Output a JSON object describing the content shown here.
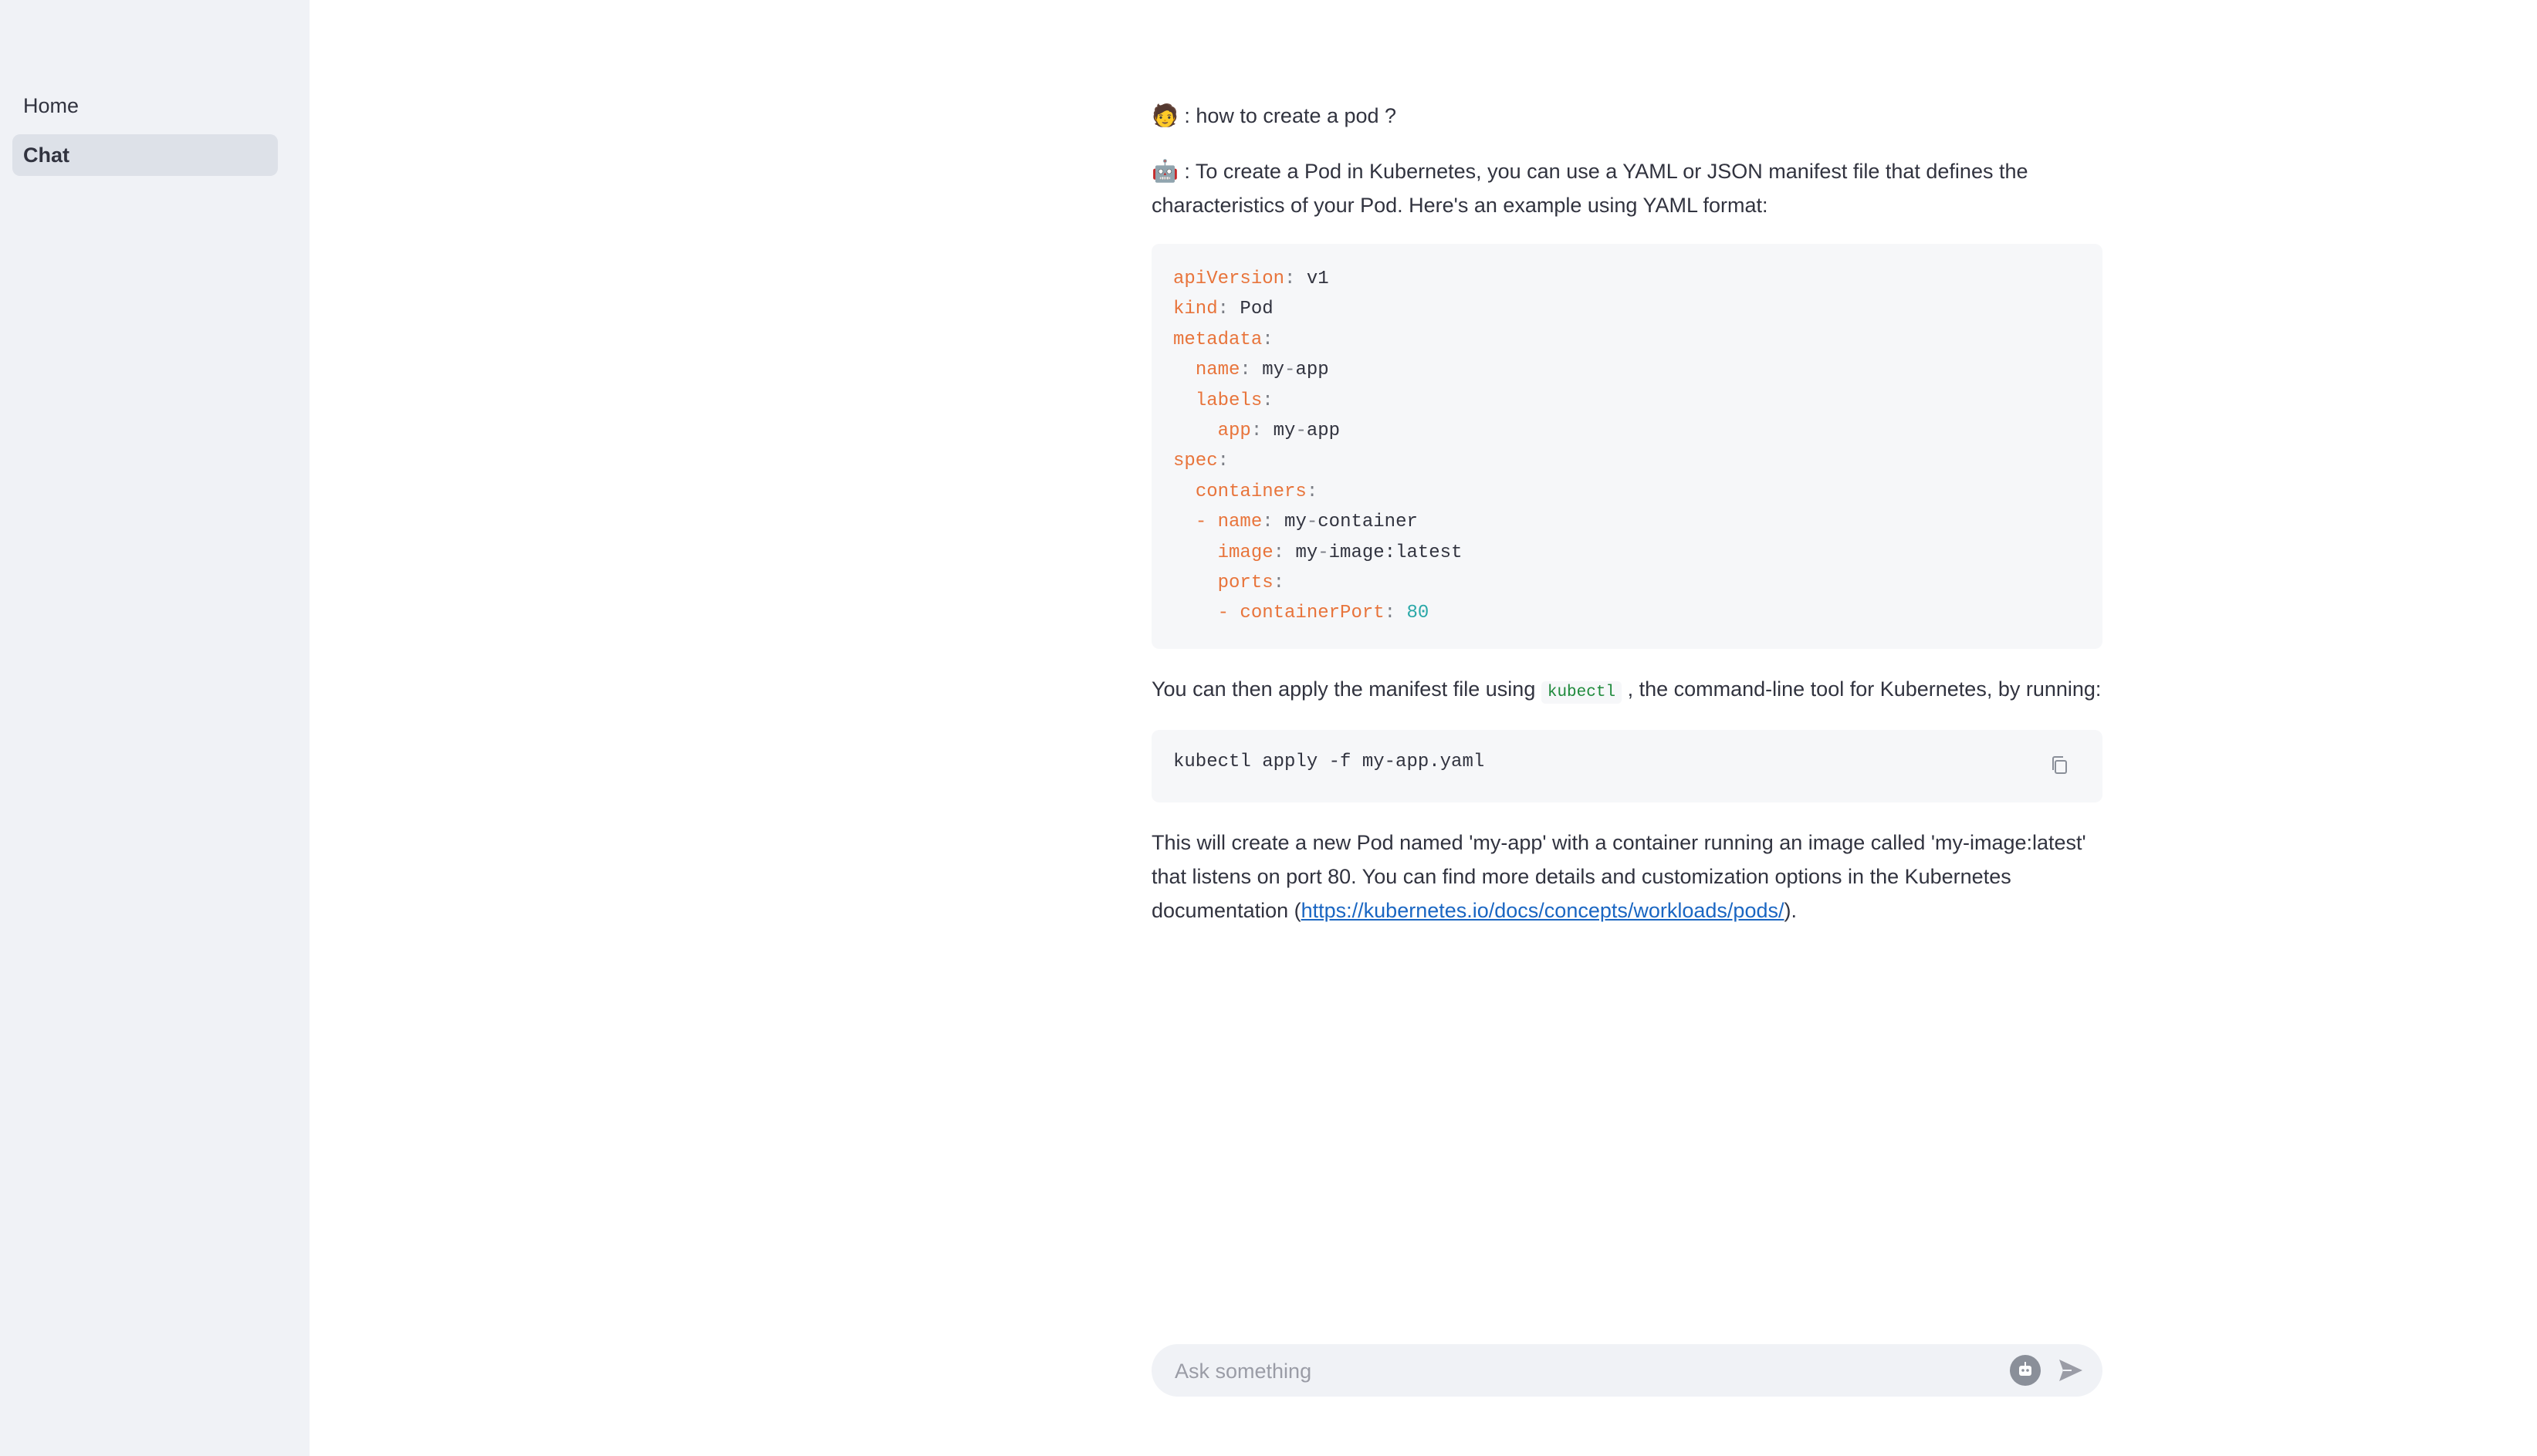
{
  "sidebar": {
    "items": [
      {
        "label": "Home",
        "active": false
      },
      {
        "label": "Chat",
        "active": true
      }
    ]
  },
  "chat": {
    "user_avatar": "🧑",
    "bot_avatar": "🤖",
    "user_message": " : how to create a pod ?",
    "bot_intro": " : To create a Pod in Kubernetes, you can use a YAML or JSON manifest file that defines the characteristics of your Pod. Here's an example using YAML format:",
    "yaml_lines": [
      {
        "indent": "",
        "key": "apiVersion",
        "sep": ": ",
        "value": "v1"
      },
      {
        "indent": "",
        "key": "kind",
        "sep": ": ",
        "value": "Pod"
      },
      {
        "indent": "",
        "key": "metadata",
        "sep": ":",
        "value": ""
      },
      {
        "indent": "  ",
        "key": "name",
        "sep": ": ",
        "value": "my-app"
      },
      {
        "indent": "  ",
        "key": "labels",
        "sep": ":",
        "value": ""
      },
      {
        "indent": "    ",
        "key": "app",
        "sep": ": ",
        "value": "my-app"
      },
      {
        "indent": "",
        "key": "spec",
        "sep": ":",
        "value": ""
      },
      {
        "indent": "  ",
        "key": "containers",
        "sep": ":",
        "value": ""
      },
      {
        "indent": "  ",
        "dash": "- ",
        "key": "name",
        "sep": ": ",
        "value": "my-container"
      },
      {
        "indent": "    ",
        "key": "image",
        "sep": ": ",
        "value": "my-image:latest"
      },
      {
        "indent": "    ",
        "key": "ports",
        "sep": ":",
        "value": ""
      },
      {
        "indent": "    ",
        "dash": "- ",
        "key": "containerPort",
        "sep": ": ",
        "number": "80"
      }
    ],
    "apply_text_before": "You can then apply the manifest file using ",
    "apply_inline_code": "kubectl",
    "apply_text_after": " , the command-line tool for Kubernetes, by running:",
    "command": "kubectl apply -f my-app.yaml",
    "closing_text": "This will create a new Pod named 'my-app' with a container running an image called 'my-image:latest' that listens on port 80. You can find more details and customization options in the Kubernetes documentation (",
    "closing_link": "https://kubernetes.io/docs/concepts/workloads/pods/",
    "closing_end": ")."
  },
  "input": {
    "placeholder": "Ask something"
  },
  "colors": {
    "sidebar_bg": "#f0f2f6",
    "active_item_bg": "#dde1e8",
    "yaml_key": "#e8743b",
    "yaml_number": "#2aa8a8",
    "inline_code": "#1f8a3c",
    "link": "#1a66c2"
  }
}
